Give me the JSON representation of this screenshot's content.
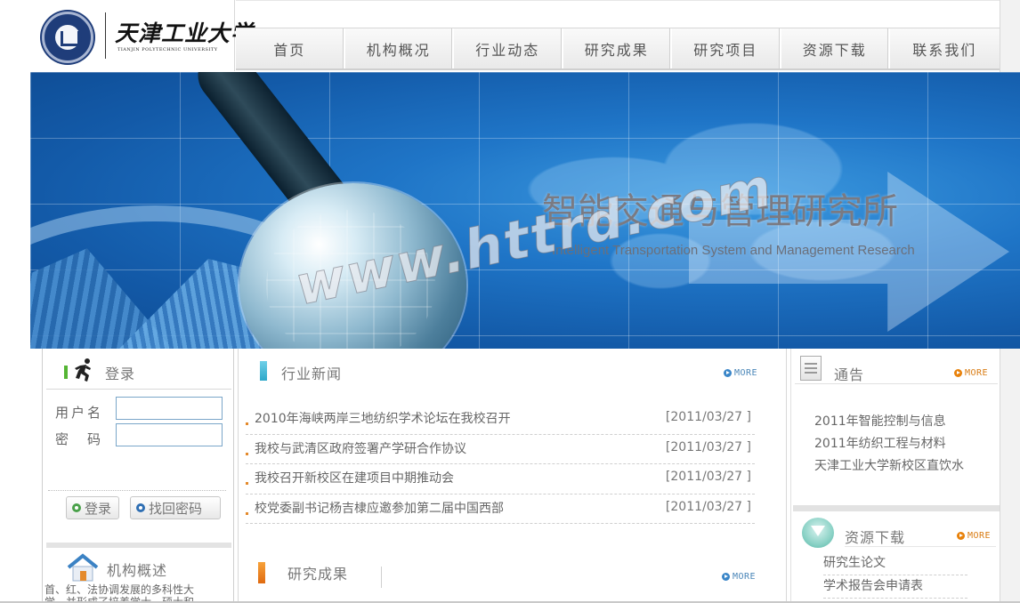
{
  "brand": {
    "name_cn": "天津工业大学",
    "name_en": "TIANJIN POLYTECHNIC UNIVERSITY"
  },
  "nav": {
    "items": [
      "首页",
      "机构概况",
      "行业动态",
      "研究成果",
      "研究项目",
      "资源下载",
      "联系我们"
    ]
  },
  "banner": {
    "title": "智能交通与管理研究所",
    "subtitle": "Intelligent Transportation System and Management Research",
    "watermark": "www.httrd.com"
  },
  "login": {
    "title": "登录",
    "username_label": "用户名",
    "password_label": "密　码",
    "username_value": "",
    "password_value": "",
    "login_button": "登录",
    "recover_button": "找回密码"
  },
  "org": {
    "title": "机构概述",
    "excerpt_line1": "首、红、法协调发展的多科性大",
    "excerpt_line2": "学，并形成了培养学士、硕士和"
  },
  "news": {
    "title": "行业新闻",
    "more_label": "MORE",
    "items": [
      {
        "title": "2010年海峡两岸三地纺织学术论坛在我校召开",
        "date": "[2011/03/27 ]"
      },
      {
        "title": "我校与武清区政府签署产学研合作协议",
        "date": "[2011/03/27 ]"
      },
      {
        "title": "我校召开新校区在建项目中期推动会",
        "date": "[2011/03/27 ]"
      },
      {
        "title": "校党委副书记杨吉棣应邀参加第二届中国西部",
        "date": "[2011/03/27 ]"
      }
    ]
  },
  "research": {
    "title": "研究成果",
    "more_label": "MORE"
  },
  "notice": {
    "title": "通告",
    "more_label": "MORE",
    "items": [
      "2011年智能控制与信息",
      "2011年纺织工程与材料",
      "天津工业大学新校区直饮水"
    ]
  },
  "downloads": {
    "title": "资源下载",
    "more_label": "MORE",
    "items": [
      "研究生论文",
      "学术报告会申请表"
    ]
  },
  "colors": {
    "login_accent": "#55b534",
    "news_accent": "#2ea8c9",
    "research_accent": "#e06a10",
    "more_accent": "#e8810a",
    "more_news_accent": "#3a86c8",
    "login_icon_accent": "#4aa14a",
    "recover_icon_accent": "#2f6fb3"
  }
}
